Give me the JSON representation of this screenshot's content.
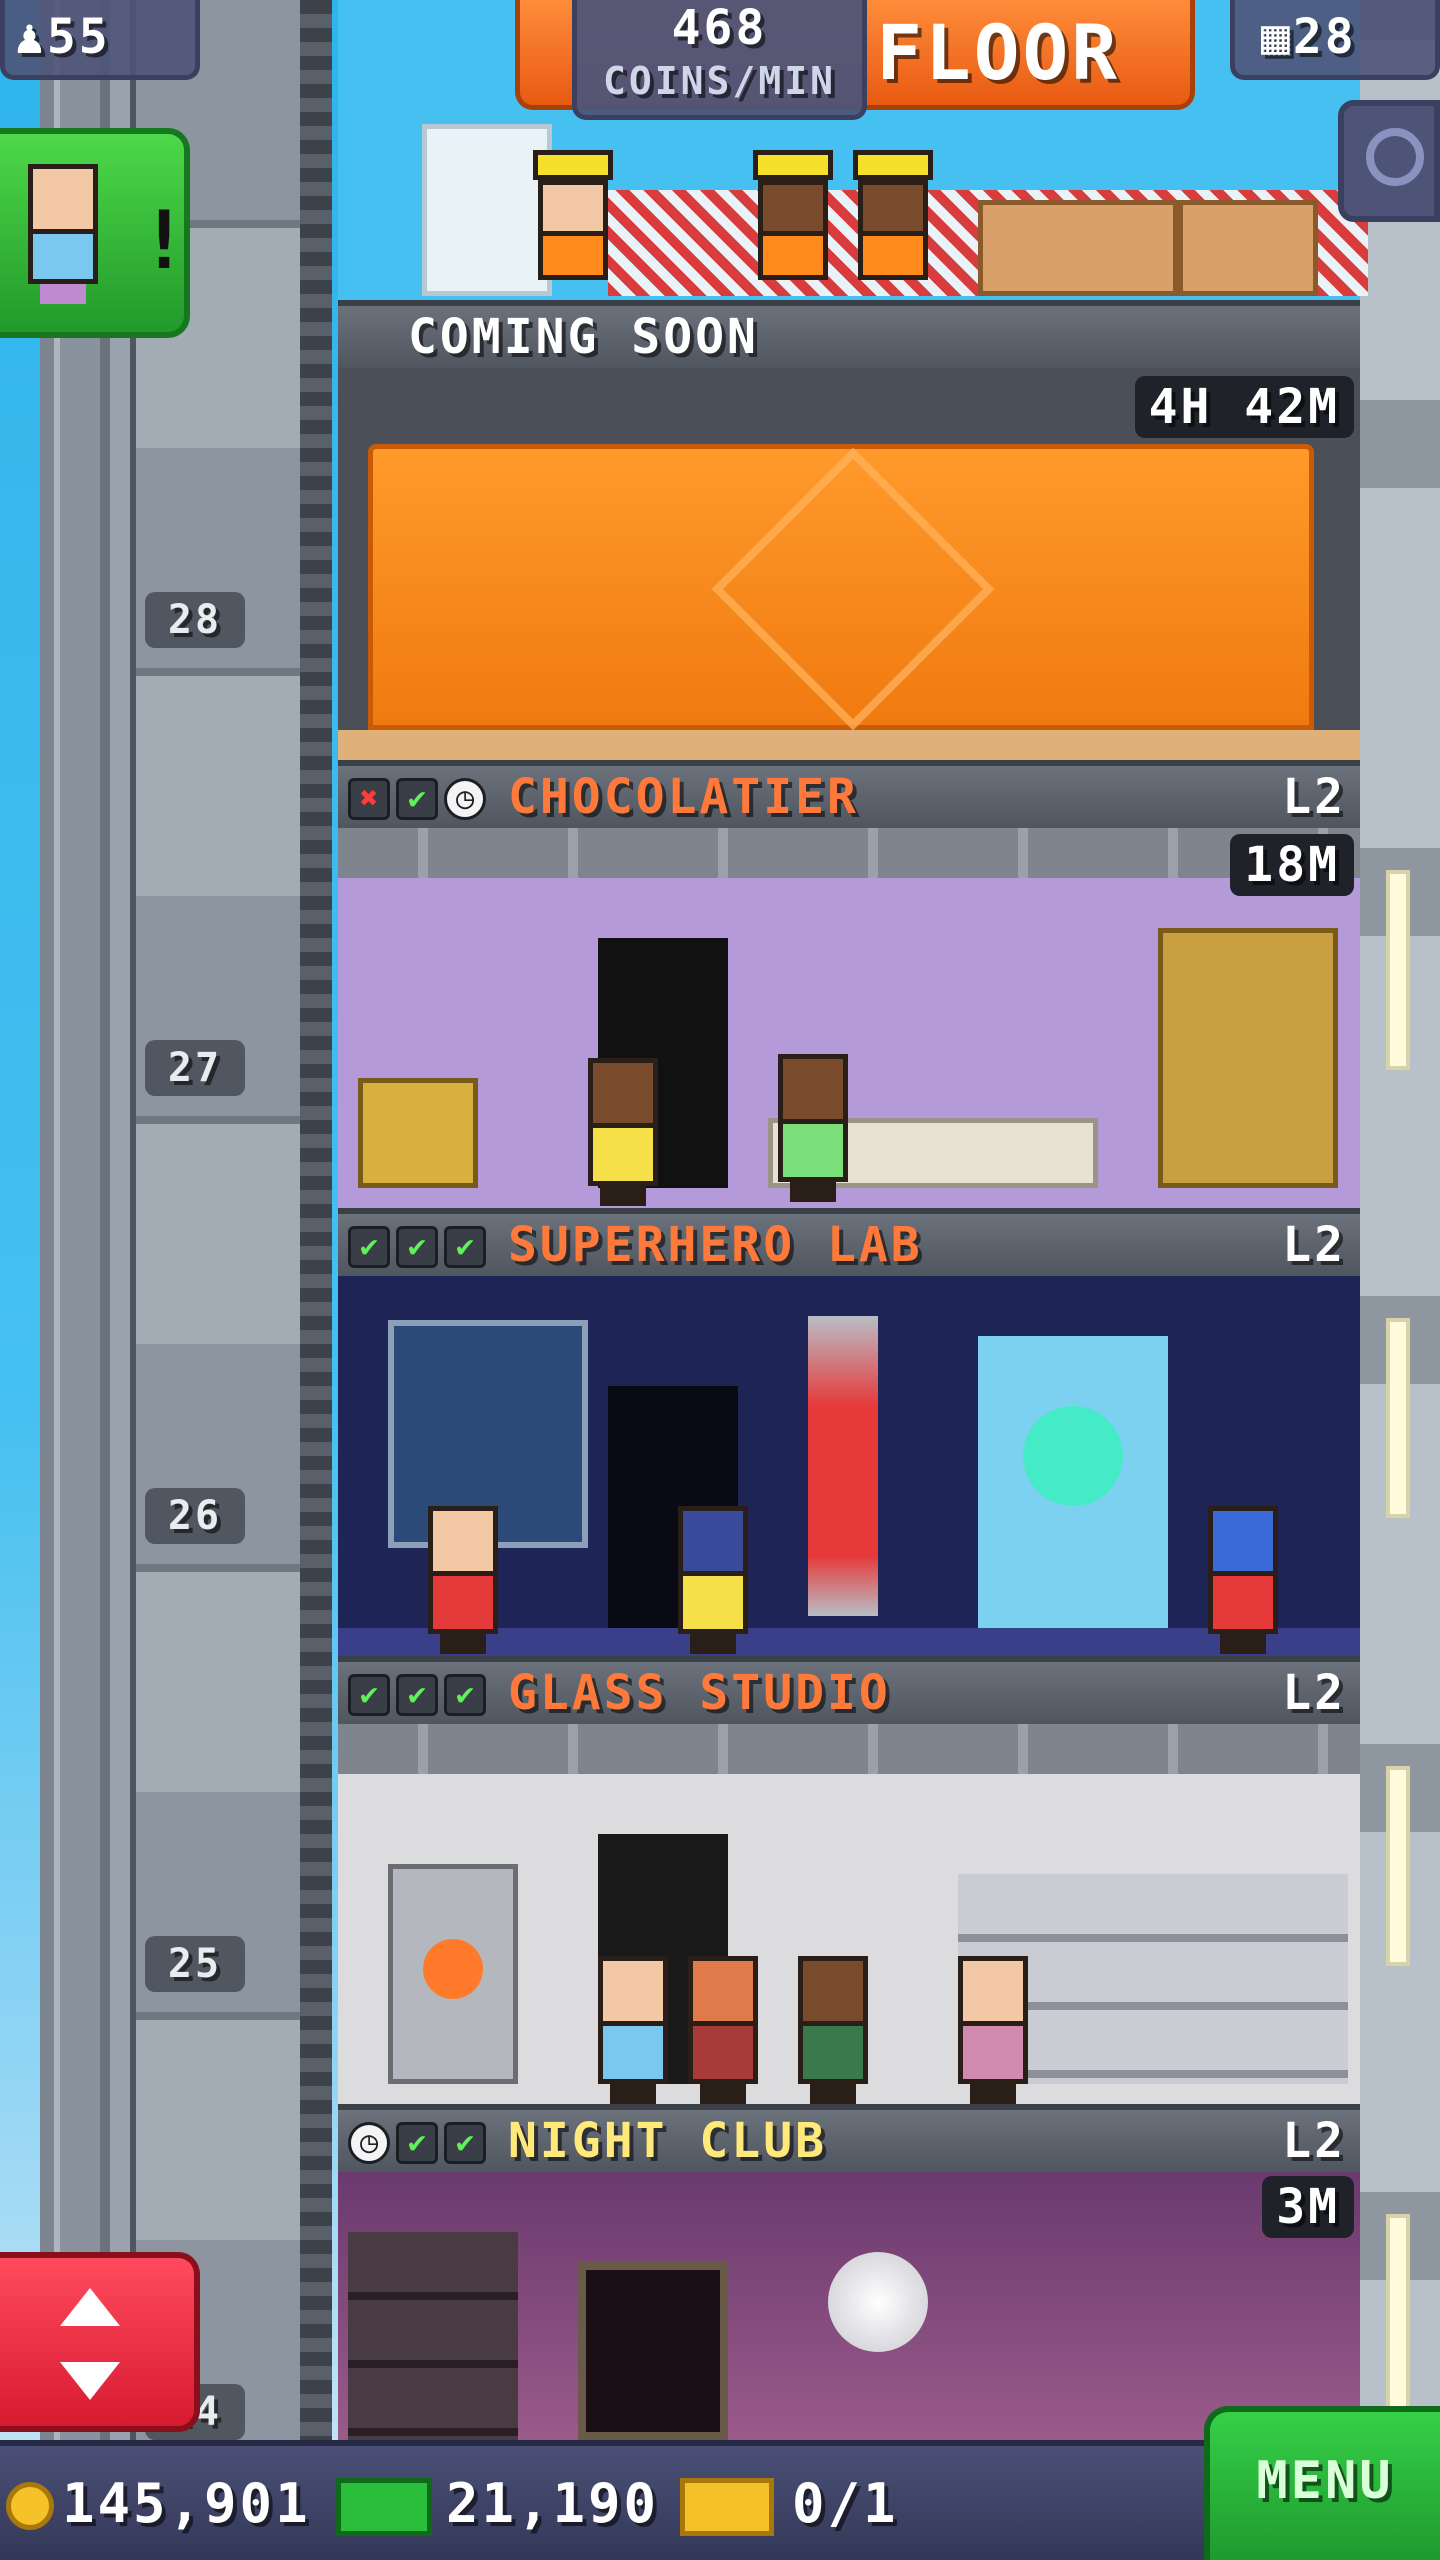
{
  "hud": {
    "population": "55",
    "coins_per_min_value": "468",
    "coins_per_min_label": "COINS/MIN",
    "banner_text": "FLOOR",
    "floor_count": "28"
  },
  "top_floor": {
    "status": "COMING SOON",
    "timer": "4H 42M"
  },
  "shaft": {
    "numbers": [
      "28",
      "27",
      "26",
      "25",
      "24"
    ]
  },
  "floors": [
    {
      "name": "CHOCOLATIER",
      "level": "L2",
      "timer": "18M",
      "name_color": "#ff7a3a",
      "stock_icons": [
        "cross",
        "check",
        "clock"
      ]
    },
    {
      "name": "SUPERHERO LAB",
      "level": "L2",
      "timer": "",
      "name_color": "#ff7a3a",
      "stock_icons": [
        "check",
        "check",
        "check"
      ]
    },
    {
      "name": "GLASS STUDIO",
      "level": "L2",
      "timer": "",
      "name_color": "#ff7a3a",
      "stock_icons": [
        "check",
        "check",
        "check"
      ]
    },
    {
      "name": "NIGHT CLUB",
      "level": "L2",
      "timer": "3M",
      "name_color": "#ffe97a",
      "stock_icons": [
        "clock",
        "check",
        "check"
      ]
    }
  ],
  "bottom": {
    "coins": "145,901",
    "bux": "21,190",
    "tickets": "0/1",
    "menu_label": "MENU"
  },
  "icons": {
    "population": "person-icon",
    "floors": "building-icon",
    "zoom": "zoom-out-icon",
    "visitor_alert": "visitor-alert-icon",
    "elevator": "elevator-arrows-icon",
    "coin": "coin-icon",
    "bux": "tower-bux-icon",
    "ticket": "golden-ticket-icon"
  },
  "colors": {
    "accent_orange": "#ff7a3a",
    "check_green": "#5ff05a",
    "cross_red": "#ff3d3d",
    "menu_green": "#2bbd3c",
    "elevator_red": "#e8253c"
  }
}
